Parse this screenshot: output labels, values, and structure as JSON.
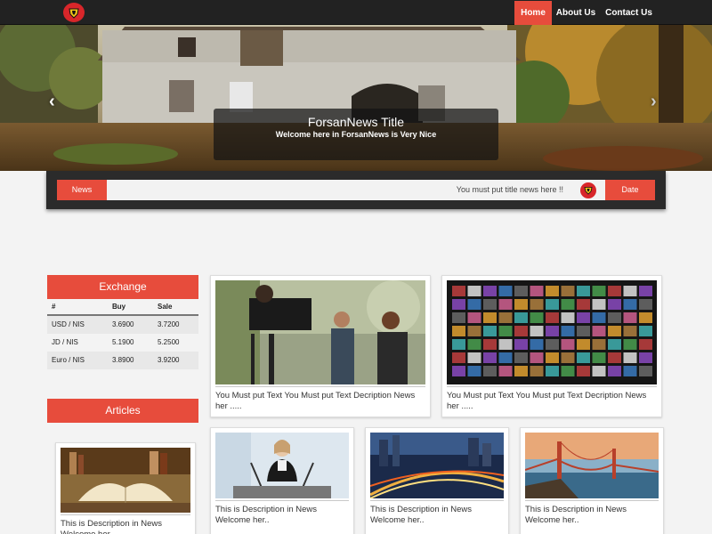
{
  "nav": {
    "home": "Home",
    "about": "About Us",
    "contact": "Contact Us"
  },
  "hero": {
    "title": "ForsanNews Title",
    "subtitle": "Welcome here in ForsanNews is Very Nice",
    "prev_glyph": "‹",
    "next_glyph": "›",
    "slides_count": 3,
    "active_slide": 2
  },
  "ticker": {
    "news_label": "News",
    "news_text": "You must put title news here !!",
    "date_label": "Date"
  },
  "exchange": {
    "title": "Exchange",
    "headers": [
      "#",
      "Buy",
      "Sale"
    ],
    "rows": [
      [
        "USD / NIS",
        "3.6900",
        "3.7200"
      ],
      [
        "JD / NIS",
        "5.1900",
        "5.2500"
      ],
      [
        "Euro / NIS",
        "3.8900",
        "3.9200"
      ]
    ]
  },
  "articles": {
    "title": "Articles",
    "items": [
      {
        "desc": "This is Description in News Welcome her.."
      }
    ]
  },
  "featured": [
    {
      "desc": "You Must put Text You Must put Text Decription News her ....."
    },
    {
      "desc": "You Must put Text You Must put Text Decription News her ....."
    }
  ],
  "news": [
    {
      "desc": "This is Description in News Welcome her.."
    },
    {
      "desc": "This is Description in News Welcome her.."
    },
    {
      "desc": "This is Description in News Welcome her.."
    }
  ],
  "colors": {
    "accent": "#e74c3c",
    "navbar": "#222222",
    "ticker": "#2b2b2b",
    "logo_red": "#d8262a"
  },
  "icons": {
    "logo": "shield-emblem-icon",
    "prev": "chevron-left-icon",
    "next": "chevron-right-icon"
  }
}
